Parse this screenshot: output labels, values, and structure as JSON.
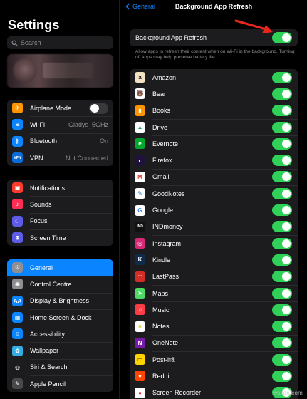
{
  "sidebar": {
    "title": "Settings",
    "search_placeholder": "Search",
    "group1": [
      {
        "label": "Airplane Mode",
        "icon": "airplane-icon",
        "color": "#ff9500",
        "value": ""
      },
      {
        "label": "Wi-Fi",
        "icon": "wifi-icon",
        "color": "#0a84ff",
        "value": "Gladys_5GHz"
      },
      {
        "label": "Bluetooth",
        "icon": "bluetooth-icon",
        "color": "#0a84ff",
        "value": "On"
      },
      {
        "label": "VPN",
        "icon": "vpn-icon",
        "color": "#0a6cd9",
        "value": "Not Connected"
      }
    ],
    "group2": [
      {
        "label": "Notifications",
        "icon": "notifications-icon",
        "color": "#ff3b30"
      },
      {
        "label": "Sounds",
        "icon": "sounds-icon",
        "color": "#ff2d55"
      },
      {
        "label": "Focus",
        "icon": "focus-moon-icon",
        "color": "#5e5ce6"
      },
      {
        "label": "Screen Time",
        "icon": "hourglass-icon",
        "color": "#5e5ce6"
      }
    ],
    "group3": [
      {
        "label": "General",
        "icon": "gear-icon",
        "color": "#8e8e93",
        "selected": true
      },
      {
        "label": "Control Centre",
        "icon": "control-centre-icon",
        "color": "#8e8e93"
      },
      {
        "label": "Display & Brightness",
        "icon": "display-icon",
        "color": "#0a84ff"
      },
      {
        "label": "Home Screen & Dock",
        "icon": "home-screen-icon",
        "color": "#0a84ff"
      },
      {
        "label": "Accessibility",
        "icon": "accessibility-icon",
        "color": "#0a84ff"
      },
      {
        "label": "Wallpaper",
        "icon": "wallpaper-icon",
        "color": "#32ade6"
      },
      {
        "label": "Siri & Search",
        "icon": "siri-icon",
        "color": "#1c1c1e"
      },
      {
        "label": "Apple Pencil",
        "icon": "pencil-icon",
        "color": "#48484a"
      }
    ]
  },
  "detail": {
    "back_label": "General",
    "title": "Background App Refresh",
    "master_label": "Background App Refresh",
    "master_on": true,
    "description": "Allow apps to refresh their content when on Wi-Fi in the background. Turning off apps may help preserve battery life.",
    "apps": [
      {
        "name": "Amazon",
        "icon": "amazon-icon",
        "color": "#f3e3c3",
        "on": true
      },
      {
        "name": "Bear",
        "icon": "bear-icon",
        "color": "#ffffff",
        "on": true
      },
      {
        "name": "Books",
        "icon": "books-icon",
        "color": "#ff9500",
        "on": true
      },
      {
        "name": "Drive",
        "icon": "drive-icon",
        "color": "#ffffff",
        "on": true
      },
      {
        "name": "Evernote",
        "icon": "evernote-icon",
        "color": "#00a82d",
        "on": true
      },
      {
        "name": "Firefox",
        "icon": "firefox-icon",
        "color": "#20123a",
        "on": true
      },
      {
        "name": "Gmail",
        "icon": "gmail-icon",
        "color": "#ffffff",
        "on": true
      },
      {
        "name": "GoodNotes",
        "icon": "goodnotes-icon",
        "color": "#ffffff",
        "on": true
      },
      {
        "name": "Google",
        "icon": "google-icon",
        "color": "#ffffff",
        "on": true
      },
      {
        "name": "INDmoney",
        "icon": "indmoney-icon",
        "color": "#111111",
        "on": true
      },
      {
        "name": "Instagram",
        "icon": "instagram-icon",
        "color": "#d62976",
        "on": true
      },
      {
        "name": "Kindle",
        "icon": "kindle-icon",
        "color": "#0f2a4a",
        "on": true
      },
      {
        "name": "LastPass",
        "icon": "lastpass-icon",
        "color": "#d32d27",
        "on": true
      },
      {
        "name": "Maps",
        "icon": "maps-icon",
        "color": "#4cd964",
        "on": true
      },
      {
        "name": "Music",
        "icon": "music-icon",
        "color": "#fc3c44",
        "on": true
      },
      {
        "name": "Notes",
        "icon": "notes-icon",
        "color": "#ffffff",
        "on": true
      },
      {
        "name": "OneNote",
        "icon": "onenote-icon",
        "color": "#7719aa",
        "on": true
      },
      {
        "name": "Post-it®",
        "icon": "postit-icon",
        "color": "#ffd400",
        "on": true
      },
      {
        "name": "Reddit",
        "icon": "reddit-icon",
        "color": "#ff4500",
        "on": true
      },
      {
        "name": "Screen Recorder",
        "icon": "screen-recorder-icon",
        "color": "#ffffff",
        "on": true
      }
    ]
  },
  "colors": {
    "accent": "#0a84ff",
    "toggle_on": "#30d158",
    "arrow": "#e8261c"
  },
  "watermark": "wsxdn.com"
}
